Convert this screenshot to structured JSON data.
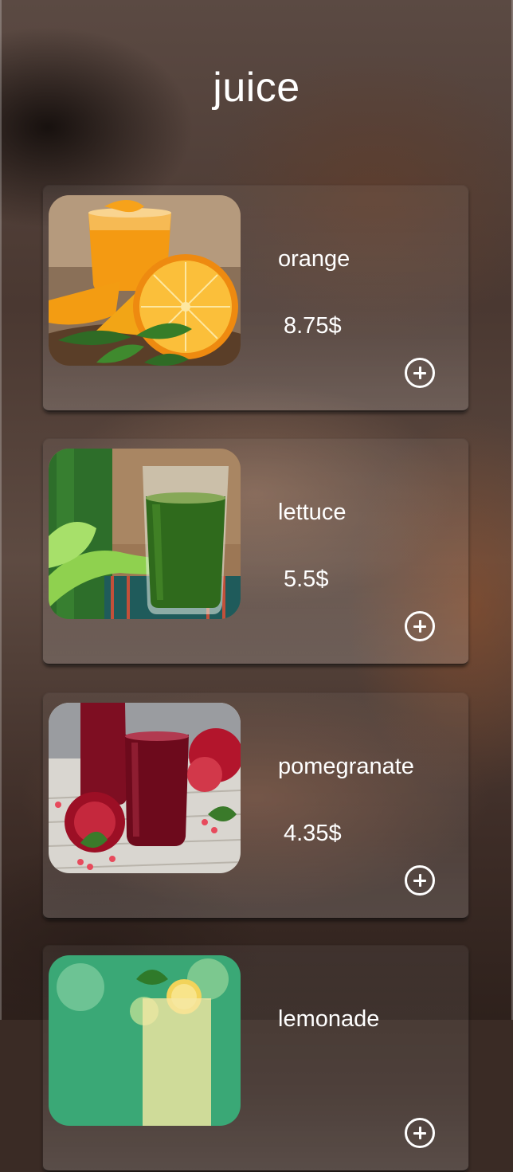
{
  "header": {
    "title": "juice"
  },
  "products": [
    {
      "name": "orange",
      "price": "8.75$",
      "photo_icon": "orange-juice-photo",
      "add_icon": "add-circle-icon"
    },
    {
      "name": "lettuce",
      "price": "5.5$",
      "photo_icon": "green-juice-photo",
      "add_icon": "add-circle-icon"
    },
    {
      "name": "pomegranate",
      "price": "4.35$",
      "photo_icon": "pomegranate-juice-photo",
      "add_icon": "add-circle-icon"
    },
    {
      "name": "lemonade",
      "price": "",
      "photo_icon": "lemonade-photo",
      "add_icon": "add-circle-icon"
    }
  ],
  "colors": {
    "text": "#ffffff",
    "background": "#4a3831",
    "card_overlay": "rgba(255,255,255,0.10)"
  }
}
